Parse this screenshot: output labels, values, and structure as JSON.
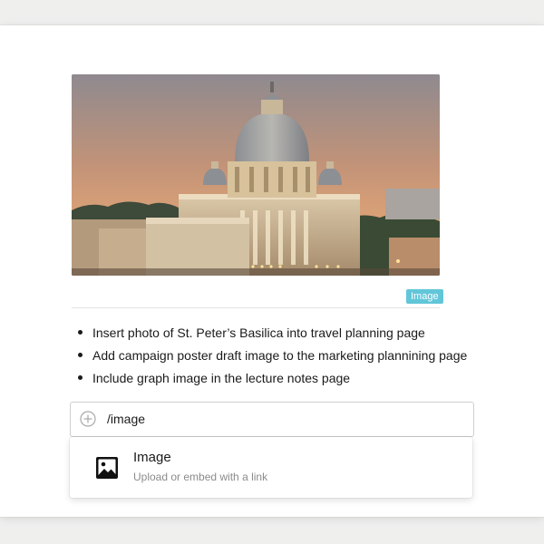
{
  "image_block": {
    "badge_label": "Image",
    "photo_subject": "St. Peter's Basilica at sunset"
  },
  "bullets": [
    "Insert photo of St. Peter’s Basilica into travel planning page",
    "Add campaign poster draft image to the marketing plannining page",
    "Include graph image in the lecture notes page"
  ],
  "command_input": {
    "value": "/image",
    "icon": "plus-circle-icon"
  },
  "dropdown": {
    "options": [
      {
        "title": "Image",
        "subtitle": "Upload or embed with a link",
        "icon": "image-icon"
      }
    ]
  },
  "colors": {
    "badge": "#62c6d9",
    "sky_top": "#8e8a8f",
    "sky_bottom": "#e6a875"
  }
}
